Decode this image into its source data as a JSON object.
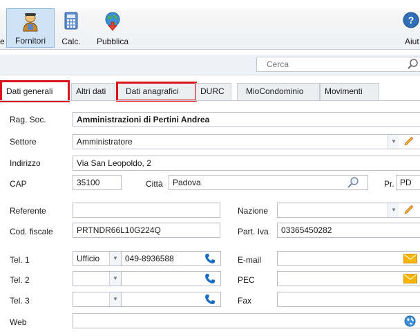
{
  "ribbon": {
    "prev_partial": "e",
    "fornitori": "Fornitori",
    "calc": "Calc.",
    "pubblica": "Pubblica",
    "aiuto_partial": "Aiut"
  },
  "search": {
    "placeholder": "Cerca"
  },
  "tabs": [
    {
      "label": "Dati generali",
      "selected": true,
      "highlighted": true
    },
    {
      "label": "Altri dati"
    },
    {
      "label": "Dati anagrafici",
      "highlighted": true
    },
    {
      "label": "DURC"
    },
    {
      "label": "MioCondominio"
    },
    {
      "label": "Movimenti"
    }
  ],
  "form": {
    "rag_soc": {
      "label": "Rag. Soc.",
      "value": "Amministrazioni di Pertini Andrea"
    },
    "settore": {
      "label": "Settore",
      "value": "Amministratore"
    },
    "indirizzo": {
      "label": "Indirizzo",
      "value": "Via San Leopoldo, 2"
    },
    "cap": {
      "label": "CAP",
      "value": "35100"
    },
    "citta": {
      "label": "Città",
      "value": "Padova"
    },
    "pr": {
      "label": "Pr.",
      "value": "PD"
    },
    "referente": {
      "label": "Referente",
      "value": ""
    },
    "nazione": {
      "label": "Nazione",
      "value": ""
    },
    "cod_fiscale": {
      "label": "Cod. fiscale",
      "value": "PRTNDR66L10G224Q"
    },
    "part_iva": {
      "label": "Part. Iva",
      "value": "03365450282"
    },
    "tel1": {
      "label": "Tel. 1",
      "type": "Ufficio",
      "value": "049-8936588"
    },
    "tel2": {
      "label": "Tel. 2",
      "type": "",
      "value": ""
    },
    "tel3": {
      "label": "Tel. 3",
      "type": "",
      "value": ""
    },
    "email": {
      "label": "E-mail",
      "value": ""
    },
    "pec": {
      "label": "PEC",
      "value": ""
    },
    "fax": {
      "label": "Fax",
      "value": ""
    },
    "web": {
      "label": "Web",
      "value": ""
    }
  },
  "colors": {
    "highlight": "#d9141b",
    "phone": "#1a6fc4",
    "mail": "#f5b400",
    "active_ribbon": "#cfe3f7"
  }
}
